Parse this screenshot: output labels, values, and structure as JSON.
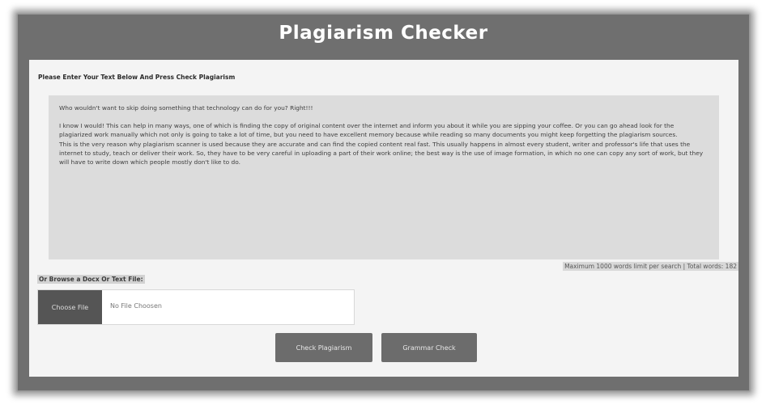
{
  "header": {
    "title": "Plagiarism Checker"
  },
  "form": {
    "instruction": "Please Enter Your Text Below And Press Check Plagiarism",
    "text_paragraphs": [
      "Who wouldn't want to skip doing something that technology can do for you? Right!!!",
      "I know I would! This can help in many ways, one of which is finding the copy of original content over the internet and inform you about it while you are sipping your coffee. Or you can go ahead look for the plagiarized work manually which not only is going to take a lot of time, but you need to have excellent memory because while reading so many documents you might keep forgetting the plagiarism sources.",
      "This is the very reason why plagiarism scanner is used because they are accurate and can find the copied content real fast. This usually happens in almost every student, writer and professor's life that uses the internet to study, teach or deliver their work. So, they have to be very careful in uploading a part of their work online; the best way is the use of image formation, in which no one can copy any sort of work, but they will have to write down which people mostly don't like to do."
    ],
    "word_count_text": "Maximum 1000 words limit per search | Total words: 182",
    "browse_label": "Or Browse a Docx Or Text File:",
    "choose_file_label": "Choose File",
    "no_file_text": "No File Choosen"
  },
  "actions": {
    "check_label": "Check Plagiarism",
    "grammar_label": "Grammar Check"
  }
}
